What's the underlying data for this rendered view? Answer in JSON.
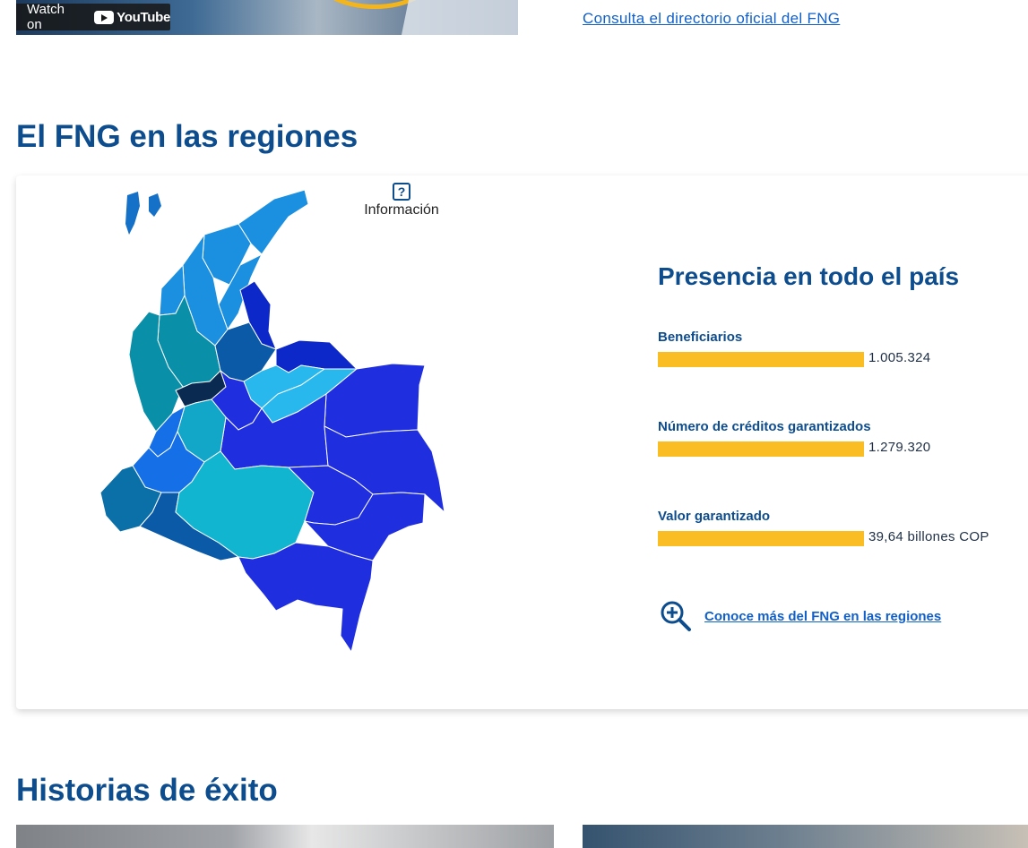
{
  "video": {
    "watch_label": "Watch on",
    "youtube_label": "YouTube"
  },
  "directory_link": "Consulta el directorio oficial del FNG",
  "regions": {
    "title": "El FNG en las regiones",
    "info_label": "Información",
    "info_icon": "help-square-icon",
    "presence_title": "Presencia en todo el país",
    "stats": [
      {
        "label": "Beneficiarios",
        "value": "1.005.324"
      },
      {
        "label": "Número de créditos garantizados",
        "value": "1.279.320"
      },
      {
        "label": "Valor garantizado",
        "value": "39,64 billones COP"
      }
    ],
    "more_link": "Conoce más del FNG en las regiones",
    "more_icon": "zoom-in-icon",
    "colors": {
      "bar": "#fbbd24",
      "heading": "#0d4d8e",
      "link": "#1160c9"
    }
  },
  "stories": {
    "title": "Historias de éxito"
  }
}
